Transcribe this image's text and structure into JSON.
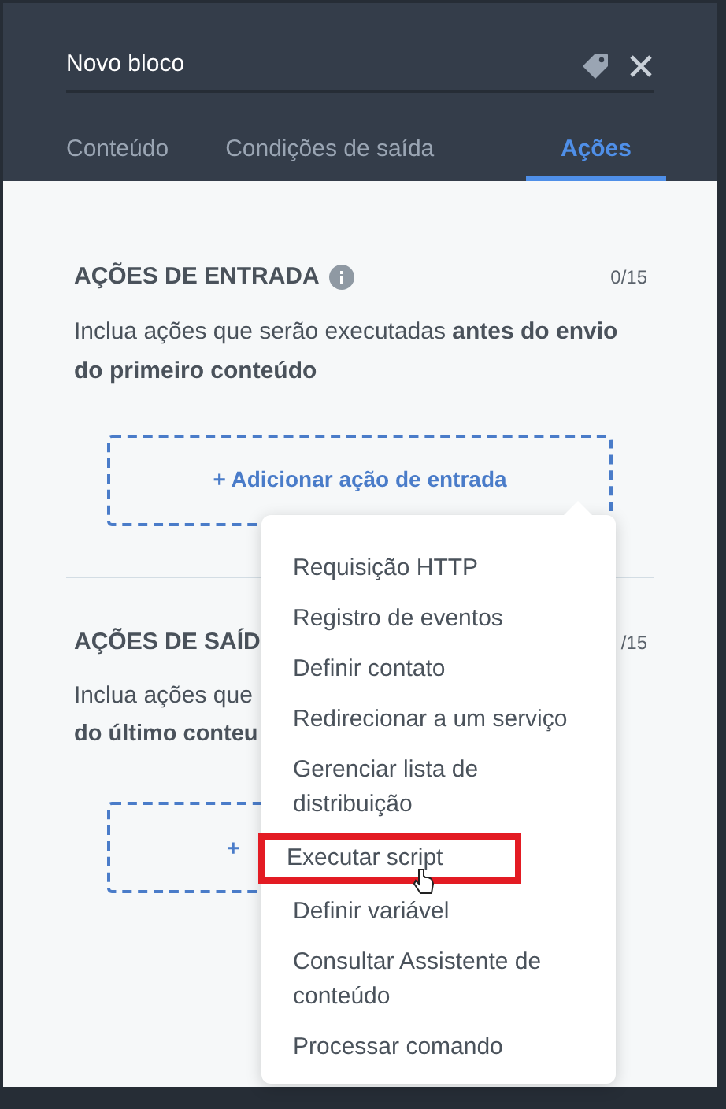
{
  "header": {
    "title": "Novo bloco"
  },
  "tabs": [
    {
      "label": "Conteúdo",
      "selected": false
    },
    {
      "label": "Condições de saída",
      "selected": false
    },
    {
      "label": "Ações",
      "selected": true
    }
  ],
  "sections": [
    {
      "title": "AÇÕES DE ENTRADA",
      "count": "0/15",
      "description": "Inclua ações que serão executadas **antes do envio do primeiro conteúdo**",
      "add_label": "+ Adicionar ação de entrada"
    },
    {
      "title": "AÇÕES DE SAÍD",
      "count": "/15",
      "description_lines": [
        "Inclua ações que",
        "do último conteu"
      ],
      "add_label": "+"
    }
  ],
  "menu": {
    "items": [
      {
        "label": "Requisição HTTP",
        "selected": false
      },
      {
        "label": "Registro de eventos",
        "selected": false
      },
      {
        "label": "Definir contato",
        "selected": false
      },
      {
        "label": "Redirecionar a um serviço",
        "selected": false
      },
      {
        "label": "Gerenciar lista de distribuição",
        "selected": false
      },
      {
        "label": "Executar script",
        "selected": true
      },
      {
        "label": "Definir variável",
        "selected": false
      },
      {
        "label": "Consultar Assistente de conteúdo",
        "selected": false
      },
      {
        "label": "Processar comando",
        "selected": false
      }
    ]
  }
}
